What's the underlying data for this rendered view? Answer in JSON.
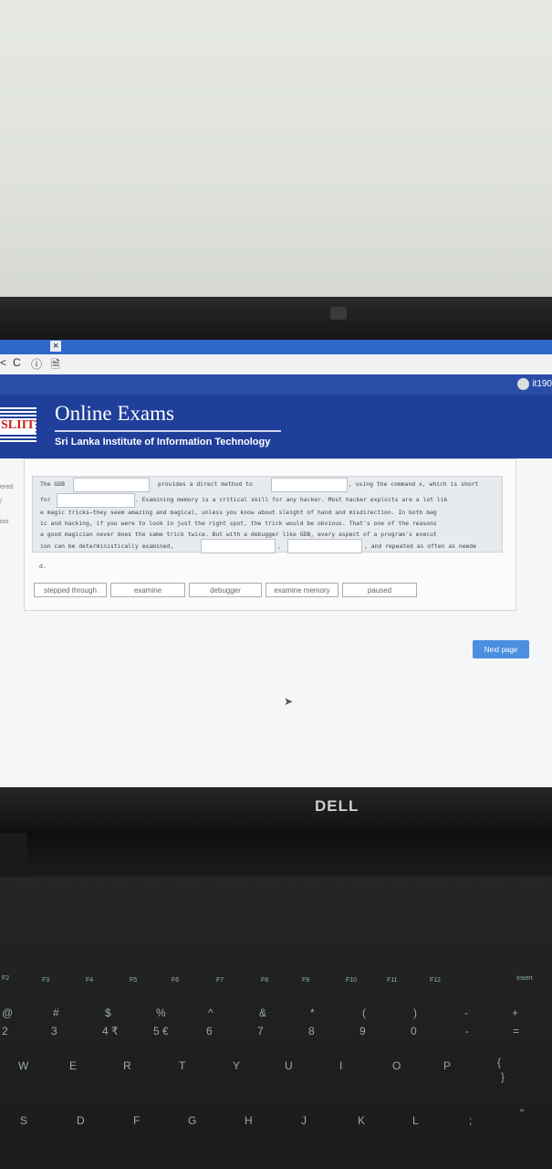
{
  "browser": {
    "close_glyph": "×",
    "back_glyph": "<",
    "reload_glyph": "C",
    "info_glyph": "ⓘ",
    "page_glyph": "🗎"
  },
  "user": {
    "name": "it190"
  },
  "header": {
    "logo_text": "SLIIT",
    "title": "Online Exams",
    "subtitle": "Sri Lanka Institute of Information Technology"
  },
  "sidebar": {
    "fragment1": "ered",
    "fragment2": "/",
    "fragment3": "ion"
  },
  "question": {
    "line1a": "The GDB",
    "line1b": "provides a direct method to",
    "line1c": ", using the command x, which is short",
    "line2a": "for",
    "line2b": ". Examining memory is a critical skill for any hacker. Most hacker exploits are a lot lik",
    "line3": "e magic tricks—they seem amazing and magical, unless you know about sleight of hand and misdirection. In both mag",
    "line4": "ic and hacking, if you were to look in just the right spot, the trick would be obvious. That's one of the reasons",
    "line5": "a good magician never does the same trick twice. But with a debugger like GDB, every aspect of a program's execut",
    "line6a": "ion can be deterministically examined,",
    "line6b": ",",
    "line6c": ", and repeated as often as neede",
    "line7": "d."
  },
  "options": [
    "stepped through",
    "examine",
    "debugger",
    "examine memory",
    "paused"
  ],
  "next_button": "Next page",
  "laptop_brand": "DELL",
  "keyboard": {
    "fkeys": [
      "F2",
      "F3",
      "F4",
      "F5",
      "F6",
      "F7",
      "F8",
      "F9",
      "F10",
      "F11",
      "F12",
      "Insert"
    ],
    "row_numbers": [
      "@",
      "#",
      "$",
      "%",
      "^",
      "&",
      "*",
      "(",
      ")",
      "-",
      "+"
    ],
    "row_digits": [
      "2",
      "3",
      "4 ₹",
      "5 €",
      "6",
      "7",
      "8",
      "9",
      "0",
      "-",
      "="
    ],
    "row_qwerty": [
      "W",
      "E",
      "R",
      "T",
      "Y",
      "U",
      "I",
      "O",
      "P",
      "{",
      "}"
    ],
    "row_asdf": [
      "S",
      "D",
      "F",
      "G",
      "H",
      "J",
      "K",
      "L",
      ";",
      "\""
    ]
  }
}
